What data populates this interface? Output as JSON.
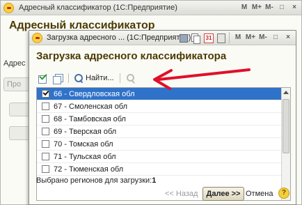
{
  "background_window": {
    "title": "Адресный классификатор  (1С:Предприятие)",
    "heading": "Адресный классификатор",
    "stub_label": "Адрес",
    "stub_button": "Про",
    "titlebar_buttons": [
      "M",
      "M+",
      "M-",
      "□",
      "×"
    ]
  },
  "dialog": {
    "title": "Загрузка адресного ...  (1С:Предприятие)",
    "titlebar_buttons": [
      "M",
      "M+",
      "M-",
      "□",
      "×"
    ],
    "heading": "Загрузка адресного классификатора",
    "toolbar": {
      "check_all_icon": "check-all-icon",
      "uncheck_all_icon": "uncheck-all-icon",
      "find_label": "Найти...",
      "cancel_search_icon": "cancel-search-icon"
    },
    "regions": [
      {
        "label": "66 - Свердловская обл",
        "checked": true,
        "selected": true
      },
      {
        "label": "67 - Смоленская обл",
        "checked": false,
        "selected": false
      },
      {
        "label": "68 - Тамбовская обл",
        "checked": false,
        "selected": false
      },
      {
        "label": "69 - Тверская обл",
        "checked": false,
        "selected": false
      },
      {
        "label": "70 - Томская обл",
        "checked": false,
        "selected": false
      },
      {
        "label": "71 - Тульская обл",
        "checked": false,
        "selected": false
      },
      {
        "label": "72 - Тюменская обл",
        "checked": false,
        "selected": false
      }
    ],
    "footer": {
      "selected_label": "Выбрано регионов для загрузки:",
      "selected_count": "1",
      "back_label": "<< Назад",
      "next_label": "Далее >>",
      "cancel_label": "Отмена",
      "help_label": "?"
    }
  },
  "colors": {
    "heading": "#4b3a00",
    "selection": "#2f72c9",
    "annotation_arrow": "#e0102a"
  }
}
